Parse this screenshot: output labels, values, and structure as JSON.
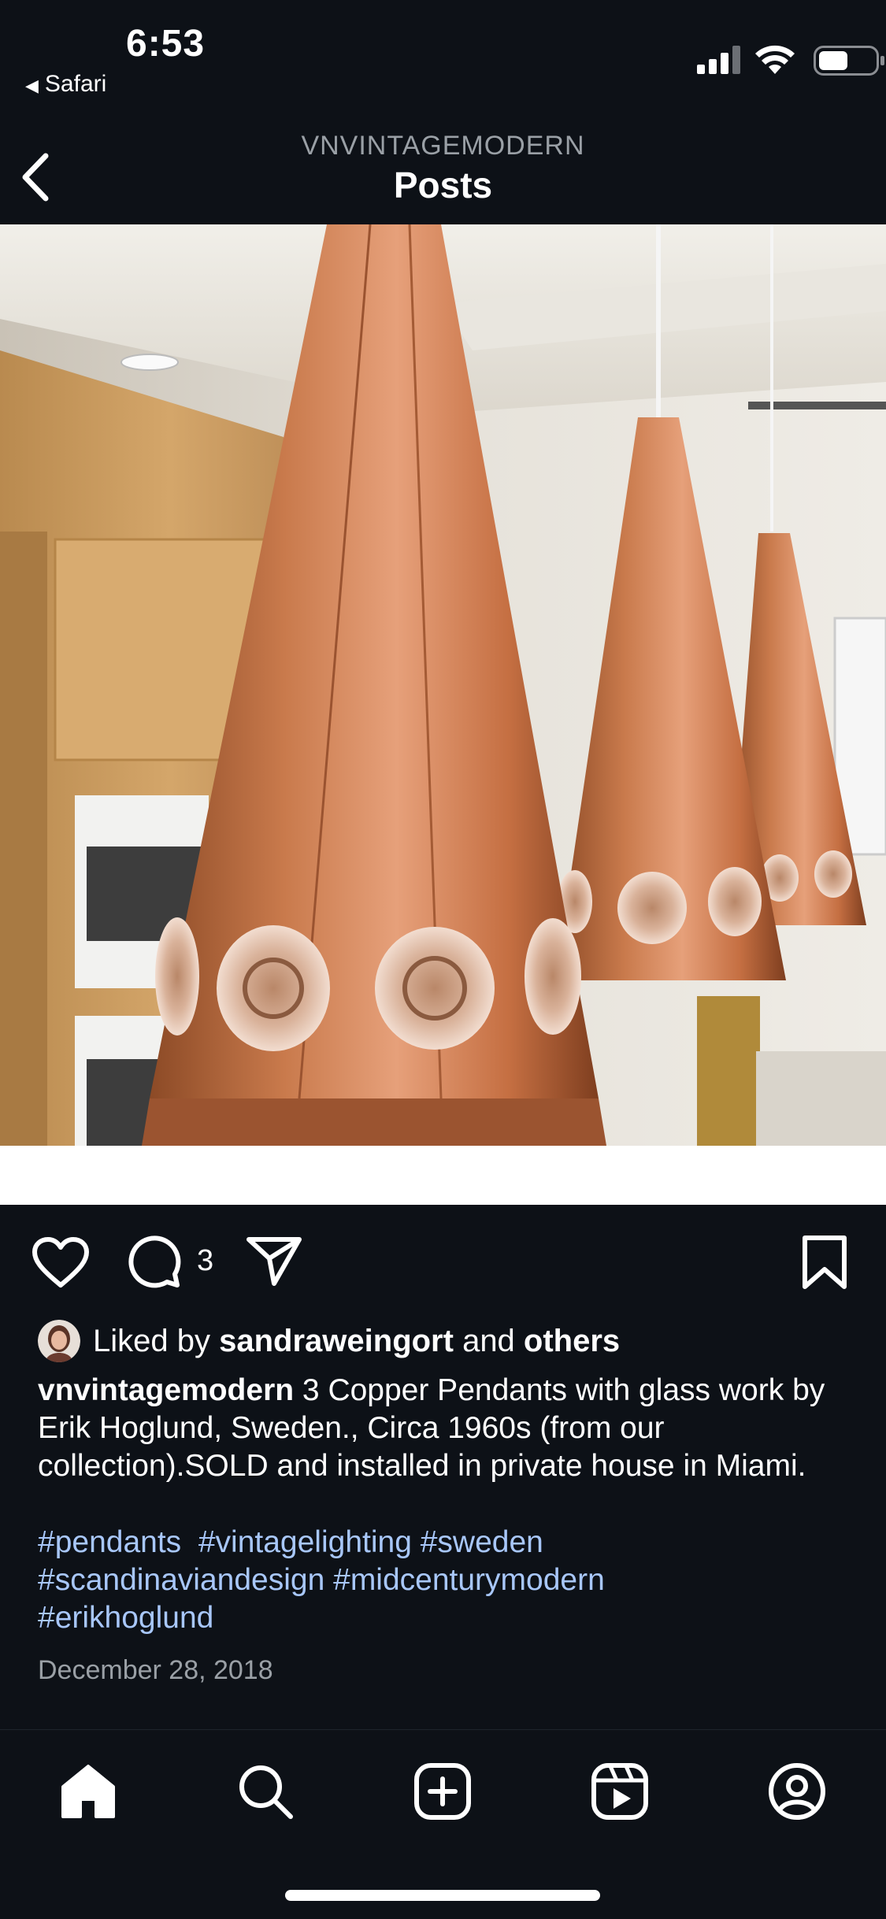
{
  "status_bar": {
    "time": "6:53",
    "back_app": "Safari"
  },
  "header": {
    "account": "VNVINTAGEMODERN",
    "title": "Posts"
  },
  "post": {
    "image_icon": "copper-pendant-lamps-photo",
    "comment_count": "3",
    "likes": {
      "prefix": "Liked by ",
      "user": "sandraweingort",
      "middle": " and ",
      "others": "others"
    },
    "caption": {
      "username": "vnvintagemodern",
      "text": " 3 Copper Pendants with glass work by Erik Hoglund, Sweden., Circa 1960s (from our collection).SOLD and installed in private house in Miami."
    },
    "hashtags": [
      "#pendants",
      "#vintagelighting",
      "#sweden",
      "#scandinaviandesign",
      "#midcenturymodern",
      "#erikhoglund"
    ],
    "date": "December 28, 2018"
  },
  "tab_bar": {
    "items": [
      "home-icon",
      "search-icon",
      "create-icon",
      "reels-icon",
      "profile-icon"
    ]
  },
  "colors": {
    "background": "#0d1117",
    "hashtag": "#a8c7fa",
    "muted": "#9aa0a6",
    "copper": "#c8794a"
  }
}
